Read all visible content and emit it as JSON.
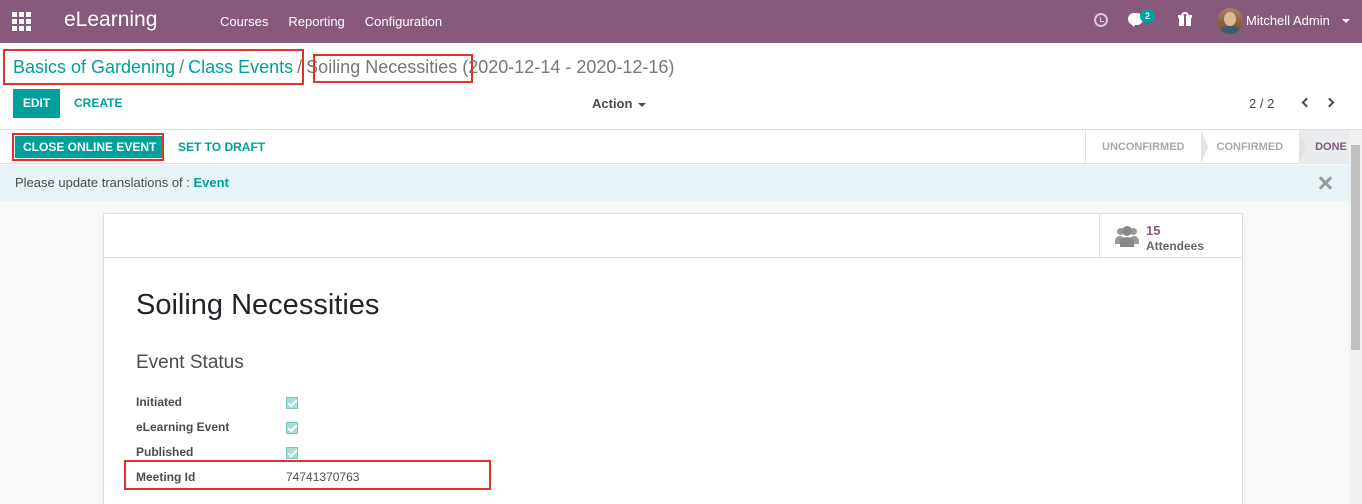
{
  "navbar": {
    "app_name": "eLearning",
    "menu": [
      "Courses",
      "Reporting",
      "Configuration"
    ],
    "chat_count": "2",
    "user_name": "Mitchell Admin"
  },
  "breadcrumb": {
    "items": [
      "Basics of Gardening",
      "Class Events"
    ],
    "separator": "/",
    "current": "Soiling Necessities",
    "dates": "(2020-12-14 - 2020-12-16)"
  },
  "toolbar": {
    "edit_label": "EDIT",
    "create_label": "CREATE",
    "action_label": "Action",
    "pager": "2 / 2"
  },
  "header": {
    "close_event_label": "CLOSE ONLINE EVENT",
    "set_draft_label": "SET TO DRAFT",
    "stages": [
      "UNCONFIRMED",
      "CONFIRMED",
      "DONE"
    ],
    "active_stage": "DONE"
  },
  "alert": {
    "text": "Please update translations of : ",
    "link": "Event"
  },
  "sheet": {
    "attendees_count": "15",
    "attendees_label": "Attendees",
    "title": "Soiling Necessities",
    "section": "Event Status",
    "fields": [
      {
        "label": "Initiated",
        "checked": true
      },
      {
        "label": "eLearning Event",
        "checked": true
      },
      {
        "label": "Published",
        "checked": true
      },
      {
        "label": "Meeting Id",
        "value": "74741370763"
      }
    ]
  },
  "colors": {
    "brand": "#875a7b",
    "accent": "#00a09d",
    "highlight_box": "#e2312a"
  },
  "icons": [
    "apps-grid-icon",
    "clock-icon",
    "chat-icon",
    "gift-icon",
    "users-icon",
    "close-icon",
    "chevron-left-icon",
    "chevron-right-icon",
    "caret-down-icon"
  ]
}
